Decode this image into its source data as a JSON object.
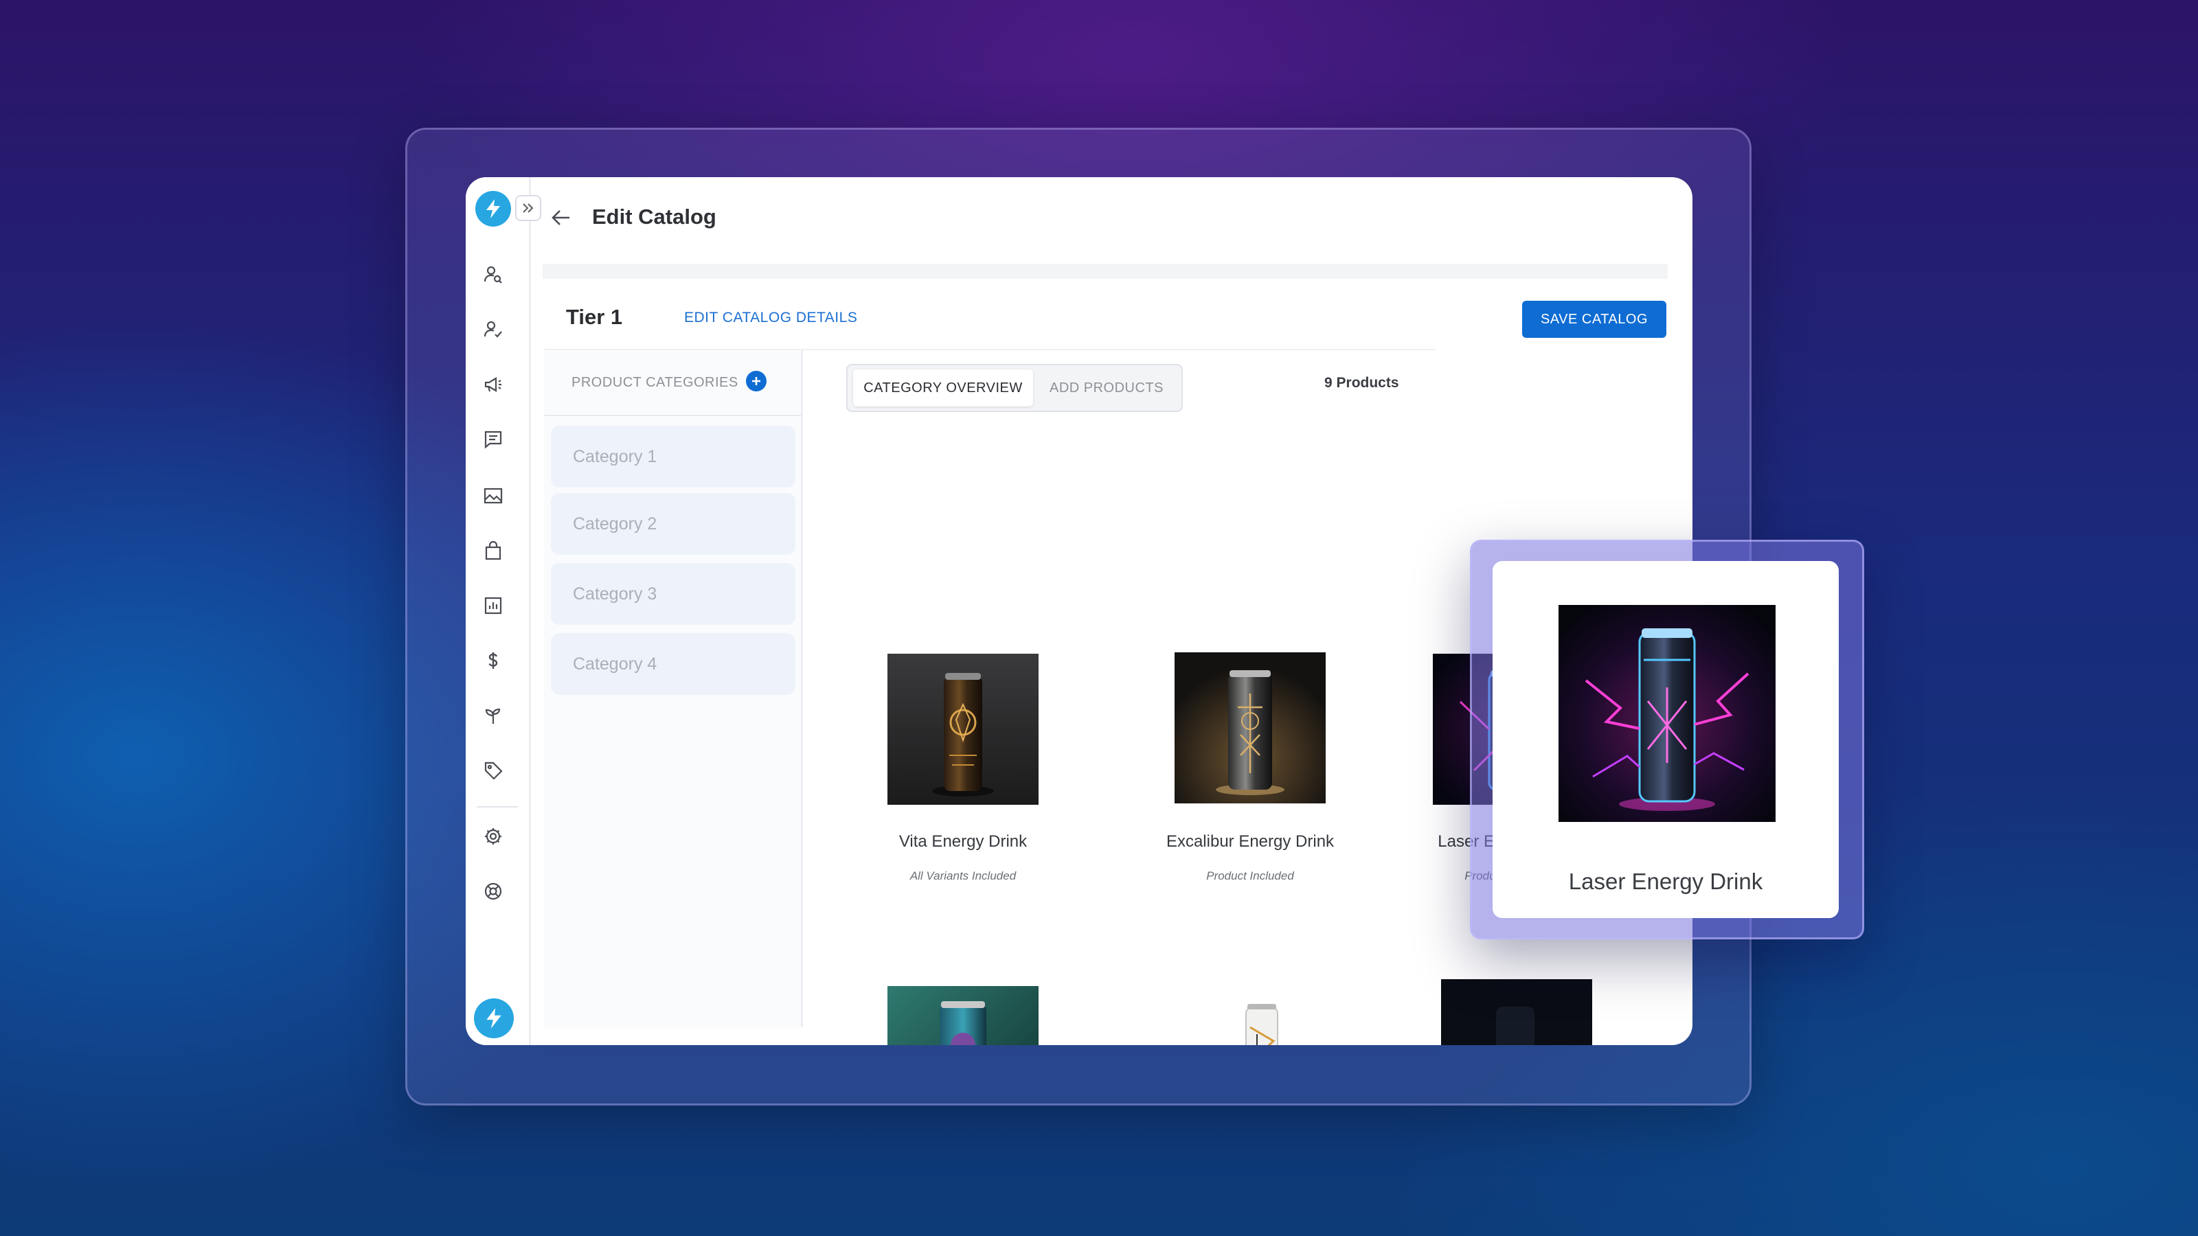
{
  "header": {
    "title": "Edit Catalog"
  },
  "catalog": {
    "name": "Tier 1",
    "edit_details_label": "EDIT CATALOG DETAILS",
    "save_label": "SAVE CATALOG",
    "product_count": "9 Products"
  },
  "categories": {
    "header": "PRODUCT CATEGORIES",
    "items": [
      "Category 1",
      "Category 2",
      "Category 3",
      "Category 4"
    ]
  },
  "tabs": [
    {
      "label": "CATEGORY OVERVIEW",
      "active": true
    },
    {
      "label": "ADD PRODUCTS",
      "active": false
    }
  ],
  "products": [
    {
      "name": "Vita Energy Drink",
      "note": "All Variants Included"
    },
    {
      "name": "Excalibur Energy Drink",
      "note": "Product Included"
    },
    {
      "name": "Laser Energy Drink",
      "note": "Product Included"
    }
  ],
  "popover": {
    "name": "Laser Energy Drink"
  },
  "sidebar": {
    "icons": [
      "user-search-icon",
      "user-check-icon",
      "megaphone-icon",
      "chat-icon",
      "image-icon",
      "shopping-bag-icon",
      "bar-chart-icon",
      "dollar-icon",
      "sprout-icon",
      "tag-icon",
      "gear-icon",
      "lifebuoy-icon"
    ]
  },
  "colors": {
    "accent": "#0f6cd3",
    "logo": "#27a6e2"
  }
}
